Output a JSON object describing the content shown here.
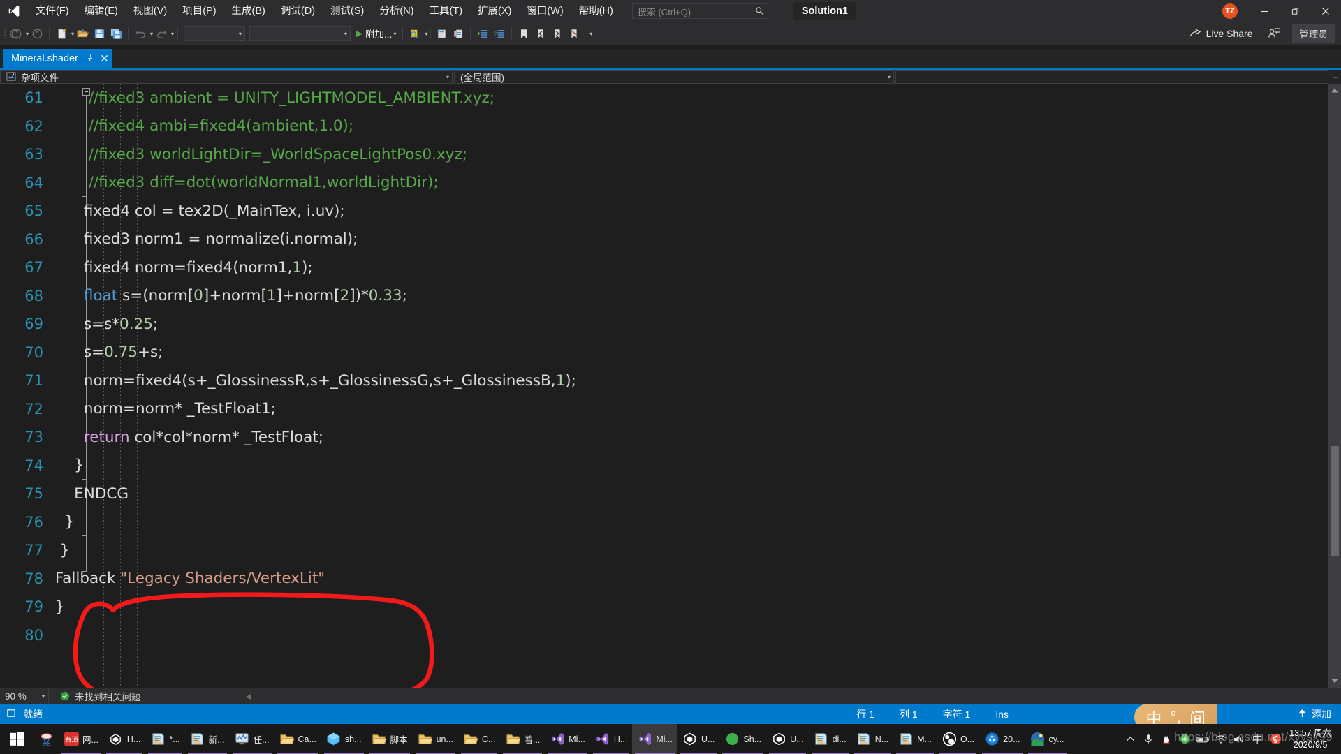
{
  "titlebar": {
    "logo_icon": "visual-studio-logo",
    "menus": [
      {
        "label": "文件(F)"
      },
      {
        "label": "编辑(E)"
      },
      {
        "label": "视图(V)"
      },
      {
        "label": "项目(P)"
      },
      {
        "label": "生成(B)"
      },
      {
        "label": "调试(D)"
      },
      {
        "label": "测试(S)"
      },
      {
        "label": "分析(N)"
      },
      {
        "label": "工具(T)"
      },
      {
        "label": "扩展(X)"
      },
      {
        "label": "窗口(W)"
      },
      {
        "label": "帮助(H)"
      }
    ],
    "search_placeholder": "搜索 (Ctrl+Q)",
    "search_icon": "search-icon",
    "solution_title": "Solution1",
    "avatar_initials": "TZ",
    "avatar_color": "#e8521f",
    "minimize_icon": "minimize-icon",
    "restore_icon": "restore-icon",
    "close_icon": "close-icon"
  },
  "toolbar": {
    "nav_back_icon": "navigate-back-icon",
    "nav_forward_icon": "navigate-forward-icon",
    "new_file_icon": "new-file-icon",
    "open_file_icon": "open-file-icon",
    "save_icon": "save-icon",
    "save_all_icon": "save-all-icon",
    "undo_icon": "undo-icon",
    "redo_icon": "redo-icon",
    "config_combo": "",
    "platform_combo": "",
    "attach_label": "附加...",
    "attach_icon": "play-icon",
    "find_icon": "find-in-files-icon",
    "comment_icon": "comment-selection-icon",
    "uncomment_icon": "uncomment-selection-icon",
    "indent_icon": "increase-indent-icon",
    "outdent_icon": "decrease-indent-icon",
    "bookmark_icon": "bookmark-icon",
    "prev_bookmark_icon": "previous-bookmark-icon",
    "next_bookmark_icon": "next-bookmark-icon",
    "clear_bookmark_icon": "clear-bookmarks-icon",
    "overflow_icon": "toolbar-overflow-icon",
    "live_share_label": "Live Share",
    "live_share_icon": "live-share-icon",
    "feedback_icon": "send-feedback-icon",
    "admin_label": "管理员"
  },
  "tabs": {
    "active_title": "Mineral.shader",
    "pin_icon": "pin-icon",
    "close_icon": "close-tab-icon"
  },
  "navbar": {
    "project_label": "杂项文件",
    "project_icon": "miscellaneous-files-icon",
    "scope_label": "(全局范围)",
    "dropdown_icon": "chevron-down-icon"
  },
  "editor": {
    "first_line_number": 61,
    "lines": [
      {
        "n": 61,
        "tokens": [
          {
            "t": "        ",
            "c": "plain"
          },
          {
            "t": "//fixed3 ambient = UNITY_LIGHTMODEL_AMBIENT.xyz;",
            "c": "cmt"
          }
        ]
      },
      {
        "n": 62,
        "tokens": [
          {
            "t": "        ",
            "c": "plain"
          },
          {
            "t": "//fixed4 ambi=fixed4(ambient,1.0);",
            "c": "cmt"
          }
        ]
      },
      {
        "n": 63,
        "tokens": [
          {
            "t": "        ",
            "c": "plain"
          },
          {
            "t": "//fixed3 worldLightDir=_WorldSpaceLightPos0.xyz;",
            "c": "cmt"
          }
        ]
      },
      {
        "n": 64,
        "tokens": [
          {
            "t": "        ",
            "c": "plain"
          },
          {
            "t": "//fixed3 diff=dot(worldNormal1,worldLightDir);",
            "c": "cmt"
          }
        ]
      },
      {
        "n": 65,
        "tokens": [
          {
            "t": "       fixed4 col = tex2D(_MainTex, i.uv);",
            "c": "plain"
          }
        ]
      },
      {
        "n": 66,
        "tokens": [
          {
            "t": "       fixed3 norm1 = normalize(i.normal);",
            "c": "plain"
          }
        ]
      },
      {
        "n": 67,
        "tokens": [
          {
            "t": "       fixed4 norm=fixed4(norm1,",
            "c": "plain"
          },
          {
            "t": "1",
            "c": "num"
          },
          {
            "t": ");",
            "c": "plain"
          }
        ]
      },
      {
        "n": 68,
        "tokens": [
          {
            "t": "       ",
            "c": "plain"
          },
          {
            "t": "float",
            "c": "kw"
          },
          {
            "t": " s=(norm[",
            "c": "plain"
          },
          {
            "t": "0",
            "c": "num"
          },
          {
            "t": "]+norm[",
            "c": "plain"
          },
          {
            "t": "1",
            "c": "num"
          },
          {
            "t": "]+norm[",
            "c": "plain"
          },
          {
            "t": "2",
            "c": "num"
          },
          {
            "t": "])*",
            "c": "plain"
          },
          {
            "t": "0.33",
            "c": "num"
          },
          {
            "t": ";",
            "c": "plain"
          }
        ]
      },
      {
        "n": 69,
        "tokens": [
          {
            "t": "       s=s*",
            "c": "plain"
          },
          {
            "t": "0.25",
            "c": "num"
          },
          {
            "t": ";",
            "c": "plain"
          }
        ]
      },
      {
        "n": 70,
        "tokens": [
          {
            "t": "       s=",
            "c": "plain"
          },
          {
            "t": "0.75",
            "c": "num"
          },
          {
            "t": "+s;",
            "c": "plain"
          }
        ]
      },
      {
        "n": 71,
        "tokens": [
          {
            "t": "       norm=fixed4(s+_GlossinessR,s+_GlossinessG,s+_GlossinessB,",
            "c": "plain"
          },
          {
            "t": "1",
            "c": "num"
          },
          {
            "t": ");",
            "c": "plain"
          }
        ]
      },
      {
        "n": 72,
        "tokens": [
          {
            "t": "       norm=norm* _TestFloat1;",
            "c": "plain"
          }
        ]
      },
      {
        "n": 73,
        "tokens": [
          {
            "t": "       ",
            "c": "plain"
          },
          {
            "t": "return",
            "c": "ret"
          },
          {
            "t": " col*col*norm* _TestFloat;",
            "c": "plain"
          }
        ]
      },
      {
        "n": 74,
        "tokens": [
          {
            "t": "     }",
            "c": "plain"
          }
        ]
      },
      {
        "n": 75,
        "tokens": [
          {
            "t": "     ENDCG",
            "c": "plain"
          }
        ]
      },
      {
        "n": 76,
        "tokens": [
          {
            "t": "   }",
            "c": "plain"
          }
        ]
      },
      {
        "n": 77,
        "tokens": [
          {
            "t": "  }",
            "c": "plain"
          }
        ]
      },
      {
        "n": 78,
        "tokens": [
          {
            "t": " Fallback ",
            "c": "plain"
          },
          {
            "t": "\"Legacy Shaders/VertexLit\"",
            "c": "str"
          }
        ]
      },
      {
        "n": 79,
        "tokens": [
          {
            "t": " }",
            "c": "plain"
          }
        ]
      },
      {
        "n": 80,
        "tokens": [
          {
            "t": "",
            "c": "plain"
          }
        ]
      }
    ],
    "annotation": {
      "type": "hand-drawn-red-ellipse",
      "color": "#f41a1a",
      "targets_line": 78
    },
    "collapse_icon": "collapse-outline-icon",
    "vertical_scrollbar_icon": "vertical-scrollbar",
    "split_handle_icon": "split-view-handle-icon",
    "add_icon": "expand-toolbar-icon"
  },
  "zoomstrip": {
    "zoom_level": "90 %",
    "dropdown_icon": "chevron-down-icon",
    "issue_status": "未找到相关问题",
    "issue_icon": "check-circle-icon",
    "collapse_icon": "collapse-left-icon"
  },
  "statusbar": {
    "ready_label": "就绪",
    "ready_icon": "ready-icon",
    "row_label": "行 1",
    "col_label": "列 1",
    "char_label": "字符 1",
    "insert_mode": "Ins",
    "add_to_source_label": "添加",
    "add_to_source_icon": "upload-arrow-icon",
    "accent_color": "#007acc"
  },
  "taskbar": {
    "start_icon": "windows-start-icon",
    "items": [
      {
        "label": "",
        "icon": "snipping-tool-icon",
        "running": false,
        "active": false
      },
      {
        "label": "网...",
        "icon": "youdao-dict-icon",
        "running": true,
        "active": false
      },
      {
        "label": "H...",
        "icon": "unity-hub-icon",
        "running": true,
        "active": false
      },
      {
        "label": "*...",
        "icon": "notepad-icon",
        "running": true,
        "active": false
      },
      {
        "label": "新...",
        "icon": "notepad-icon",
        "running": true,
        "active": false
      },
      {
        "label": "任...",
        "icon": "task-manager-icon",
        "running": true,
        "active": false
      },
      {
        "label": "Ca...",
        "icon": "folder-icon",
        "running": true,
        "active": false
      },
      {
        "label": "sh...",
        "icon": "unity-package-icon",
        "running": true,
        "active": false
      },
      {
        "label": "脚本",
        "icon": "folder-icon",
        "running": true,
        "active": false
      },
      {
        "label": "un...",
        "icon": "folder-icon",
        "running": true,
        "active": false
      },
      {
        "label": "C...",
        "icon": "folder-icon",
        "running": true,
        "active": false
      },
      {
        "label": "着...",
        "icon": "folder-icon",
        "running": true,
        "active": false
      },
      {
        "label": "Mi...",
        "icon": "visual-studio-icon",
        "running": true,
        "active": false
      },
      {
        "label": "H...",
        "icon": "visual-studio-icon",
        "running": true,
        "active": false
      },
      {
        "label": "Mi...",
        "icon": "visual-studio-icon",
        "running": true,
        "active": true
      },
      {
        "label": "U...",
        "icon": "unity-editor-icon",
        "running": true,
        "active": false
      },
      {
        "label": "Sh...",
        "icon": "shadergraph-icon",
        "running": true,
        "active": false
      },
      {
        "label": "U...",
        "icon": "unity-editor-icon",
        "running": true,
        "active": false
      },
      {
        "label": "di...",
        "icon": "notepad-icon",
        "running": true,
        "active": false
      },
      {
        "label": "N...",
        "icon": "notepad-icon",
        "running": true,
        "active": false
      },
      {
        "label": "M...",
        "icon": "notepad-icon",
        "running": true,
        "active": false
      },
      {
        "label": "O...",
        "icon": "obs-studio-icon",
        "running": true,
        "active": false
      },
      {
        "label": "20...",
        "icon": "media-player-icon",
        "running": true,
        "active": false
      },
      {
        "label": "cy...",
        "icon": "photo-icon",
        "running": true,
        "active": false
      }
    ],
    "tray": [
      {
        "icon": "chevron-up-icon"
      },
      {
        "icon": "microphone-icon"
      },
      {
        "icon": "qq-penguin-icon"
      },
      {
        "icon": "green-shield-icon"
      },
      {
        "icon": "battery-icon"
      },
      {
        "icon": "wifi-icon"
      },
      {
        "icon": "volume-icon"
      },
      {
        "icon": "ime-chinese-icon"
      },
      {
        "icon": "sogou-input-icon"
      }
    ],
    "clock_time": "13:57 周六",
    "clock_date": "2020/9/5"
  },
  "ime_overlay": {
    "mode_label": "中",
    "punct_label": "°,",
    "width_label": "间"
  },
  "watermark": "https://blog.csdn.net/xyysk99"
}
